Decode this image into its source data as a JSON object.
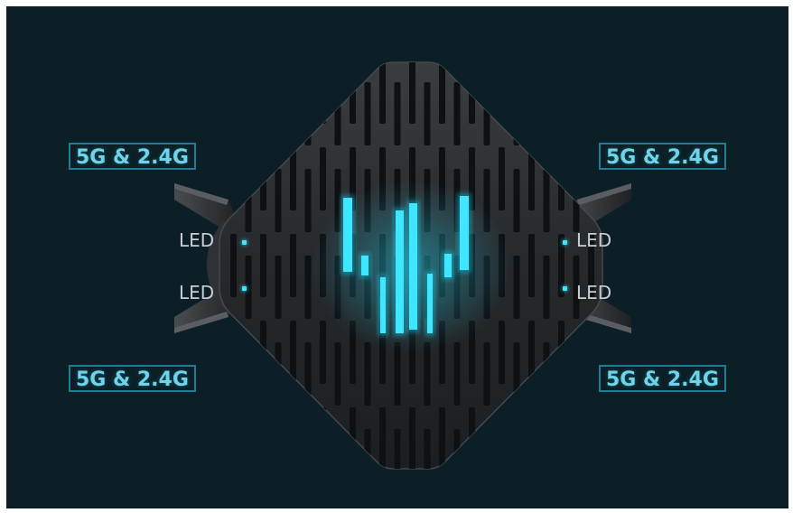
{
  "antenna_labels": {
    "top_left": "5G & 2.4G",
    "bottom_left": "5G & 2.4G",
    "top_right": "5G & 2.4G",
    "bottom_right": "5G & 2.4G"
  },
  "led_labels": {
    "left_upper": "LED",
    "left_lower": "LED",
    "right_upper": "LED",
    "right_lower": "LED"
  },
  "colors": {
    "background": "#0d1f26",
    "label_border": "#1f7d93",
    "label_text": "#6fd3ea",
    "led_glow": "#3ee6ff",
    "router_body": "#2a2d30"
  }
}
